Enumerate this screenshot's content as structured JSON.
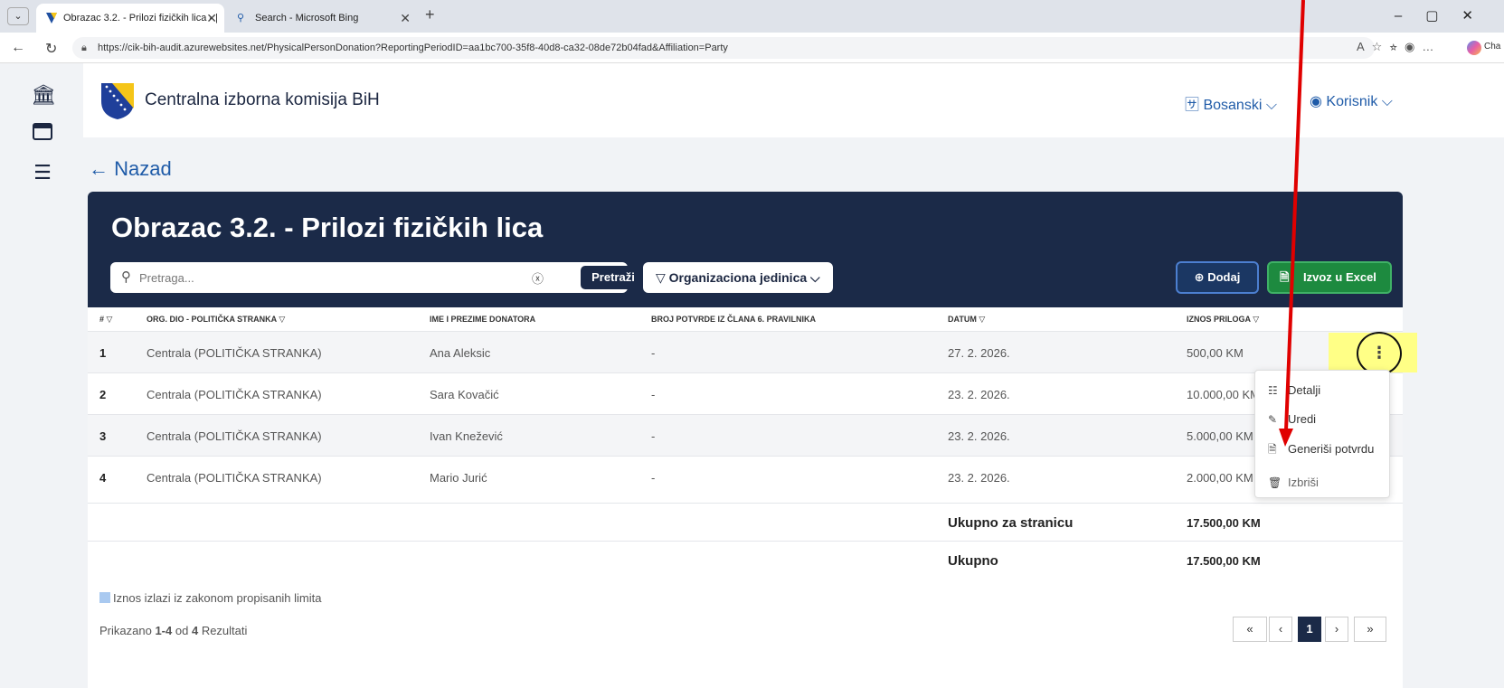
{
  "browser": {
    "tabs": [
      {
        "label": "Obrazac 3.2. - Prilozi fizičkih lica - |",
        "active": true
      },
      {
        "label": "Search - Microsoft Bing",
        "active": false
      }
    ],
    "url": "https://cik-bih-audit.azurewebsites.net/PhysicalPersonDonation?ReportingPeriodID=aa1bc700-35f8-40d8-ca32-08de72b04fad&Affiliation=Party",
    "copilot_label": "Cha"
  },
  "header": {
    "org_name": "Centralna izborna komisija BiH",
    "language": "Bosanski",
    "user": "Korisnik"
  },
  "nav": {
    "back_label": "Nazad"
  },
  "page": {
    "title": "Obrazac 3.2. - Prilozi fizičkih lica",
    "search_placeholder": "Pretraga...",
    "search_button": "Pretraži",
    "org_filter": "Organizaciona jedinica",
    "add_button": "Dodaj",
    "excel_button": "Izvoz u Excel"
  },
  "table": {
    "columns": [
      "#",
      "ORG. DIO - POLITIČKA STRANKA",
      "IME I PREZIME DONATORA",
      "BROJ POTVRDE IZ ČLANA 6. PRAVILNIKA",
      "DATUM",
      "IZNOS PRILOGA"
    ],
    "rows": [
      {
        "num": "1",
        "org": "Centrala (POLITIČKA STRANKA)",
        "donor": "Ana Aleksic",
        "confirmation": "-",
        "date": "27. 2. 2026.",
        "amount": "500,00 KM"
      },
      {
        "num": "2",
        "org": "Centrala (POLITIČKA STRANKA)",
        "donor": "Sara Kovačić",
        "confirmation": "-",
        "date": "23. 2. 2026.",
        "amount": "10.000,00 KM"
      },
      {
        "num": "3",
        "org": "Centrala (POLITIČKA STRANKA)",
        "donor": "Ivan Knežević",
        "confirmation": "-",
        "date": "23. 2. 2026.",
        "amount": "5.000,00 KM"
      },
      {
        "num": "4",
        "org": "Centrala (POLITIČKA STRANKA)",
        "donor": "Mario Jurić",
        "confirmation": "-",
        "date": "23. 2. 2026.",
        "amount": "2.000,00 KM"
      }
    ],
    "page_total_label": "Ukupno za stranicu",
    "page_total": "17.500,00 KM",
    "total_label": "Ukupno",
    "total": "17.500,00 KM",
    "legend": "Iznos izlazi iz zakonom propisanih limita",
    "results_prefix": "Prikazano",
    "results_range": "1-4",
    "results_mid": "od",
    "results_count": "4",
    "results_suffix": "Rezultati"
  },
  "pagination": {
    "first": "«",
    "prev": "‹",
    "current": "1",
    "next": "›",
    "last": "»"
  },
  "row_menu": {
    "items": [
      "Detalji",
      "Uredi",
      "Generiši potvrdu",
      "Izbriši"
    ]
  },
  "colors": {
    "navy": "#1b2a48",
    "accent_blue": "#1f5ba8",
    "excel_green": "#1d8a3f",
    "annotation_red": "#e00000",
    "highlight_yellow": "#ffff86"
  }
}
